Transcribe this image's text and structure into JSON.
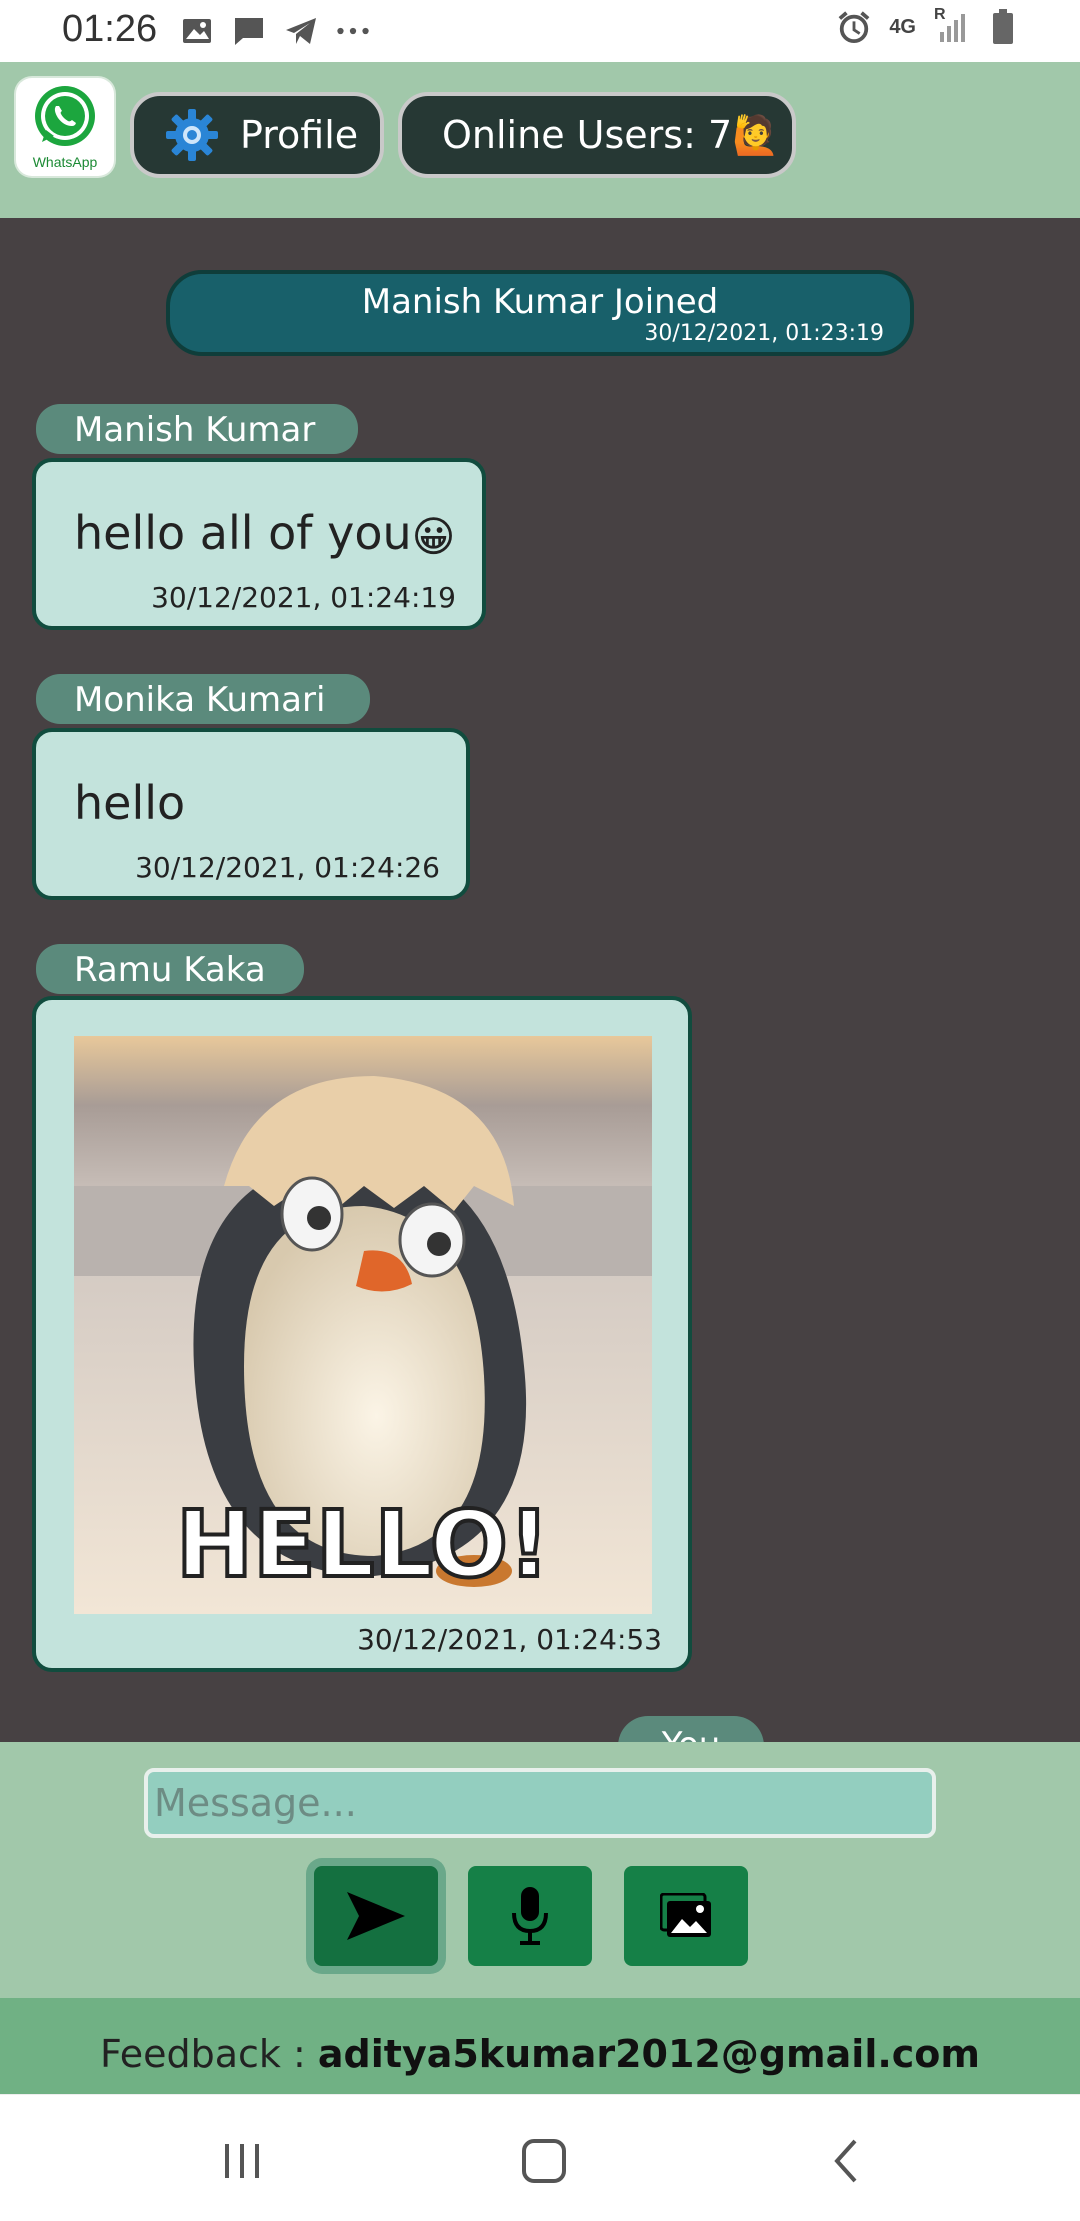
{
  "status_bar": {
    "time": "01:26",
    "network_label": "4G",
    "roaming_label": "R"
  },
  "header": {
    "logo_text": "WhatsApp",
    "profile_label": "Profile",
    "online_users_label": "Online Users: 7",
    "online_users_emoji": "🙋"
  },
  "chat": {
    "join_notice": {
      "text": "Manish Kumar Joined",
      "timestamp": "30/12/2021, 01:23:19"
    },
    "messages": [
      {
        "sender": "Manish Kumar",
        "text": "hello all of you",
        "emoji": "😀",
        "timestamp": "30/12/2021, 01:24:19"
      },
      {
        "sender": "Monika Kumari",
        "text": "hello",
        "timestamp": "30/12/2021, 01:24:26"
      },
      {
        "sender": "Ramu Kaka",
        "image_caption": "HELLO!",
        "timestamp": "30/12/2021, 01:24:53"
      }
    ],
    "you_label": "You"
  },
  "composer": {
    "placeholder": "Message...",
    "value": ""
  },
  "feedback": {
    "label": "Feedback : ",
    "email": "aditya5kumar2012@gmail.com"
  },
  "colors": {
    "header_bg": "#a1c8aa",
    "chat_bg": "#474143",
    "bubble_bg": "#c3e3dc",
    "button_green": "#158047",
    "feedback_bg": "#70b184"
  }
}
